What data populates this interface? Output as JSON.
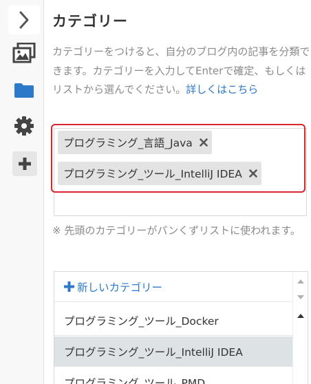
{
  "section": {
    "title": "カテゴリー",
    "description": "カテゴリーをつけると、自分のブログ内の記事を分類できます。カテゴリーを入力してEnterで確定、もしくはリストから選んでください。",
    "details_link": "詳しくはこちら"
  },
  "selected_categories": [
    {
      "label": "プログラミング_言語_Java"
    },
    {
      "label": "プログラミング_ツール_IntelliJ IDEA"
    }
  ],
  "note": "※ 先頭のカテゴリーがパンくずリストに使われます。",
  "category_list": {
    "new_category_label": "新しいカテゴリー",
    "items": [
      {
        "label": "プログラミング_ツール_Docker",
        "selected": false
      },
      {
        "label": "プログラミング_ツール_IntelliJ IDEA",
        "selected": true
      },
      {
        "label": "プログラミング_ツール_PMD",
        "selected": false
      }
    ]
  },
  "colors": {
    "accent_link": "#2c79c9",
    "highlight_border": "#d9232d",
    "tag_background": "#e3e3e3",
    "selected_row": "#dde2e5"
  },
  "icons": {
    "rail": [
      "chevron-right-icon",
      "image-icon",
      "folder-icon",
      "gear-icon",
      "plus-icon"
    ],
    "tag_remove": "close-icon",
    "scroll": [
      "scroll-up-icon",
      "scroll-down-icon"
    ]
  }
}
